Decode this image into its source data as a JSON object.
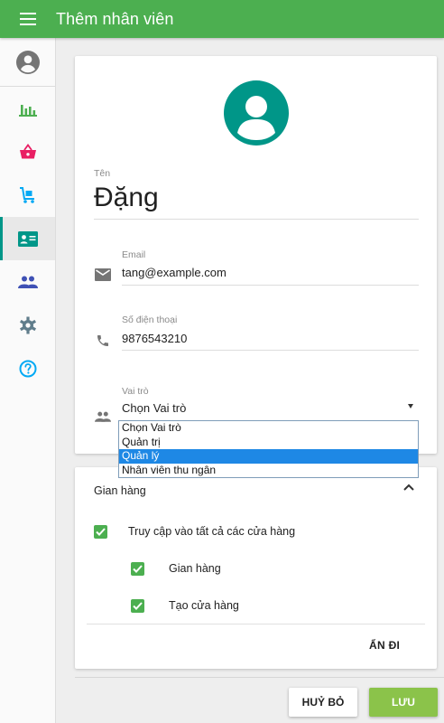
{
  "appbar": {
    "title": "Thêm nhân viên",
    "color": "#4caf50"
  },
  "sidebar": {
    "items": [
      {
        "icon": "bar-chart-icon",
        "color": "#4caf50"
      },
      {
        "icon": "shopping-basket-icon",
        "color": "#e91e63"
      },
      {
        "icon": "cart-icon",
        "color": "#03a9f4"
      },
      {
        "icon": "contact-card-icon",
        "color": "#009688",
        "active": true
      },
      {
        "icon": "people-icon",
        "color": "#3f51b5"
      },
      {
        "icon": "gear-icon",
        "color": "#607d8b"
      },
      {
        "icon": "help-icon",
        "color": "#03a9f4"
      }
    ]
  },
  "form": {
    "name_label": "Tên",
    "name_value": "Đặng",
    "email_label": "Email",
    "email_value": "tang@example.com",
    "phone_label": "Số điện thoại",
    "phone_value": "9876543210",
    "role_label": "Vai trò",
    "role_value": "Chọn Vai trò",
    "role_options": [
      "Chọn Vai trò",
      "Quản trị",
      "Quản lý",
      "Nhân viên thu ngân"
    ],
    "highlighted_option": "Quản lý"
  },
  "stores": {
    "title": "Gian hàng",
    "all_access_label": "Truy cập vào tất cả các cửa hàng",
    "store_label": "Gian hàng",
    "create_store_label": "Tạo cửa hàng",
    "hide_label": "ẨN ĐI"
  },
  "actions": {
    "cancel_label": "HUỶ BỎ",
    "save_label": "LƯU",
    "save_color": "#8bc34a"
  }
}
